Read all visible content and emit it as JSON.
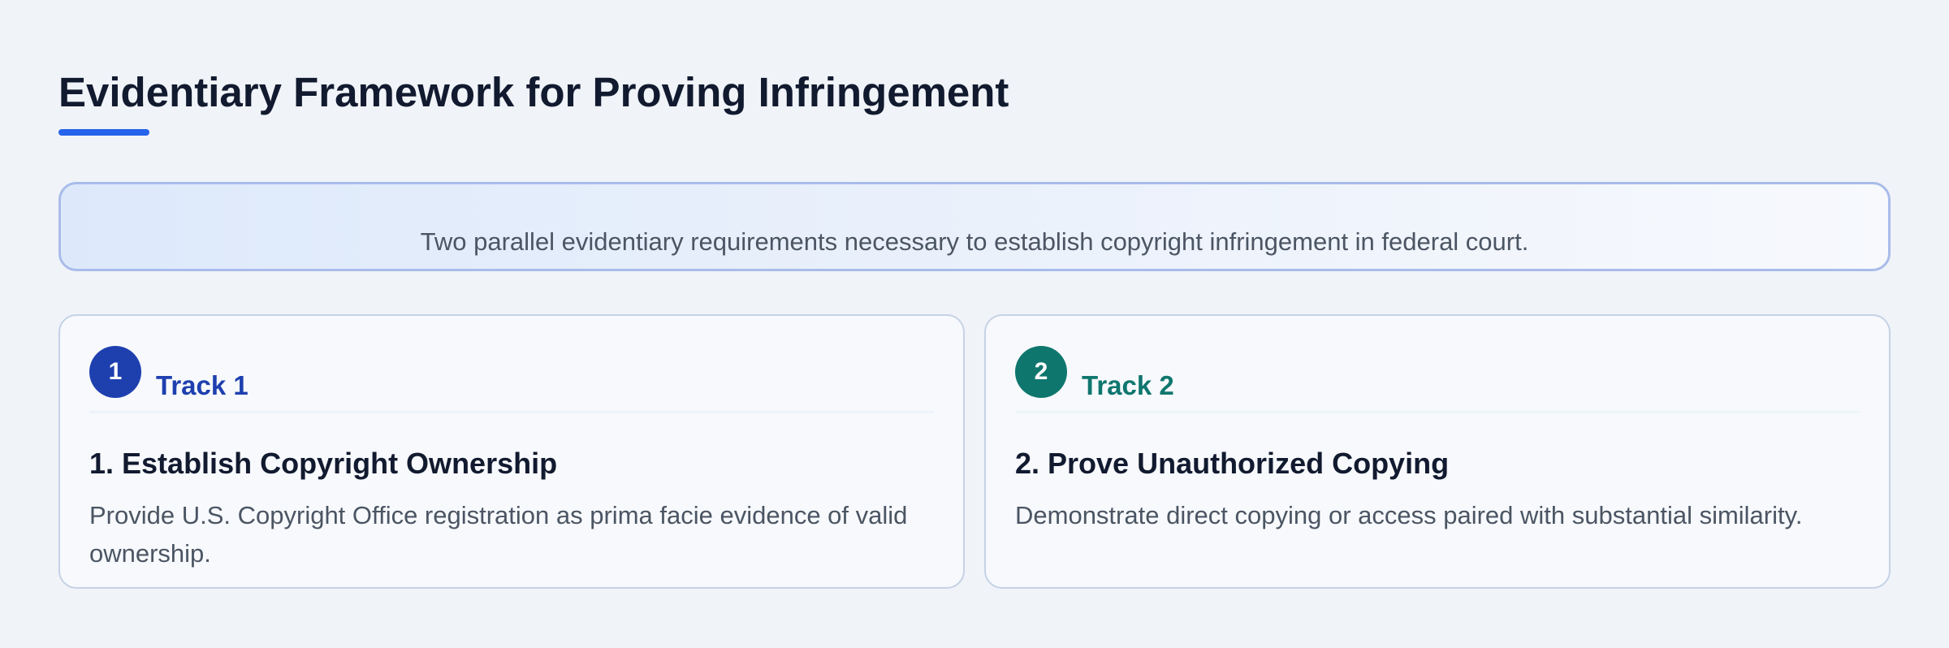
{
  "page": {
    "title": "Evidentiary Framework for Proving Infringement",
    "accent_color": "#2563eb"
  },
  "banner": {
    "text": "Two parallel evidentiary requirements necessary to establish copyright infringement in federal court."
  },
  "tracks": [
    {
      "number": "1",
      "label": "Track 1",
      "heading": "1. Establish Copyright Ownership",
      "description": "Provide U.S. Copyright Office registration as prima facie evidence of valid ownership.",
      "color": "#1e40af",
      "divider_color": "#eef2fb"
    },
    {
      "number": "2",
      "label": "Track 2",
      "heading": "2. Prove Unauthorized Copying",
      "description": "Demonstrate direct copying or access paired with substantial similarity.",
      "color": "#0f766e",
      "divider_color": "#ecf6f5"
    }
  ]
}
